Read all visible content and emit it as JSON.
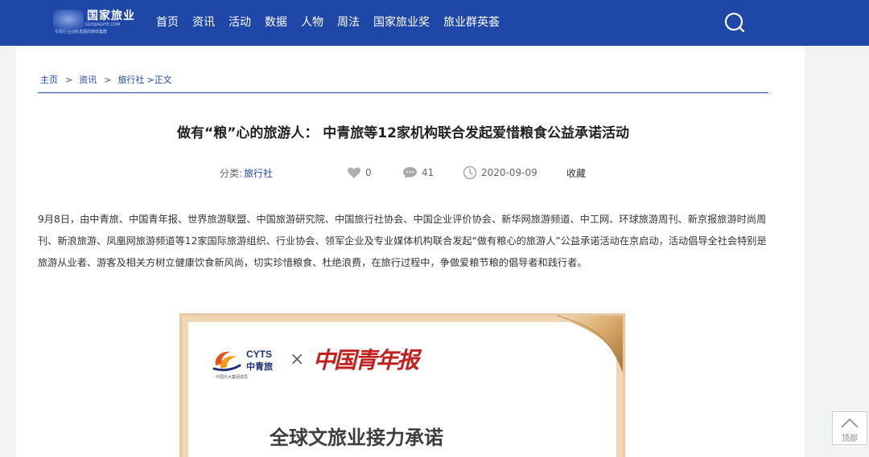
{
  "header": {
    "logo_title": "国家旅业",
    "logo_url": "GUOJIALVYE.COM",
    "logo_slogan": "引领行业创新发展的媒体集群",
    "nav": [
      "首页",
      "资讯",
      "活动",
      "数据",
      "人物",
      "周法",
      "国家旅业奖",
      "旅业群英荟"
    ],
    "search_icon": "search-icon"
  },
  "breadcrumb": {
    "items": [
      "主页",
      "资讯",
      "旅行社"
    ],
    "separator": ">",
    "current": ">正文"
  },
  "article": {
    "title": "做有“粮”心的旅游人： 中青旅等12家机构联合发起爱惜粮食公益承诺活动",
    "category_label": "分类:",
    "category_value": "旅行社",
    "likes": "0",
    "comments": "41",
    "date": "2020-09-09",
    "favorite_label": "收藏",
    "body": "9月8日，由中青旅、中国青年报、世界旅游联盟、中国旅游研究院、中国旅行社协会、中国企业评价协会、新华网旅游频道、中工网、环球旅游周刊、新京报旅游时尚周刊、新浪旅游、凤凰网旅游频道等12家国际旅游组织、行业协会、领军企业及专业媒体机构联合发起“做有粮心的旅游人”公益承诺活动在京启动，活动倡导全社会特别是旅游从业者、游客及相关方树立健康饮食新风尚，切实珍惜粮食、杜绝浪费，在旅行过程中，争做爱粮节粮的倡导者和践行者。"
  },
  "figure": {
    "cyts_logo_text": "CYTS",
    "cyts_cn": "中青旅",
    "cyts_sub": "中国光大集团成员",
    "times_sign": "×",
    "newspaper_name": "中国青年报",
    "headline": "全球文旅业接力承诺"
  },
  "back_to_top": {
    "label": "顶部"
  },
  "colors": {
    "brand_blue": "#1e47a8",
    "frame_gold": "#e8c8a0",
    "newspaper_red": "#c41f1f"
  }
}
